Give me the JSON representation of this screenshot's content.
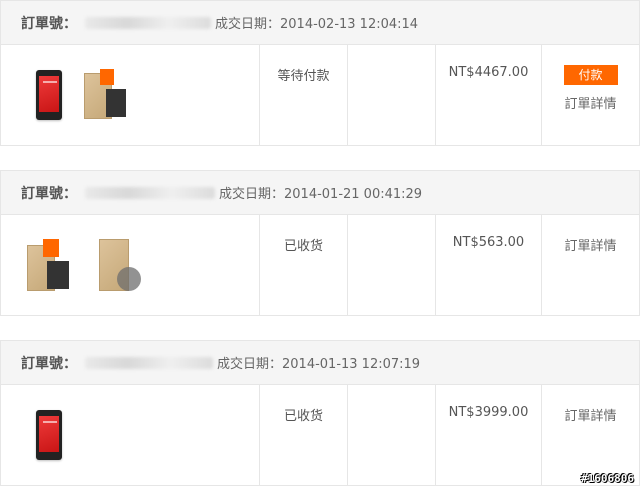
{
  "orders": [
    {
      "order_label": "訂單號：",
      "date_text": "成交日期：2014-02-13 12:04:14",
      "status": "等待付款",
      "price": "NT$4467.00",
      "pay_label": "付款",
      "detail_label": "訂單詳情",
      "items": [
        "phone-red",
        "case-box"
      ]
    },
    {
      "order_label": "訂單號：",
      "date_text": "成交日期：2014-01-21 00:41:29",
      "status": "已收货",
      "price": "NT$563.00",
      "detail_label": "訂單詳情",
      "items": [
        "case-box",
        "case-single"
      ]
    },
    {
      "order_label": "訂單號：",
      "date_text": "成交日期：2014-01-13 12:07:19",
      "status": "已收货",
      "price": "NT$3999.00",
      "detail_label": "訂單詳情",
      "items": [
        "phone-red"
      ]
    }
  ],
  "watermark": "#1606806",
  "colors": {
    "accent": "#ff6700",
    "header_bg": "#f5f5f5",
    "border": "#e6e6e6"
  }
}
